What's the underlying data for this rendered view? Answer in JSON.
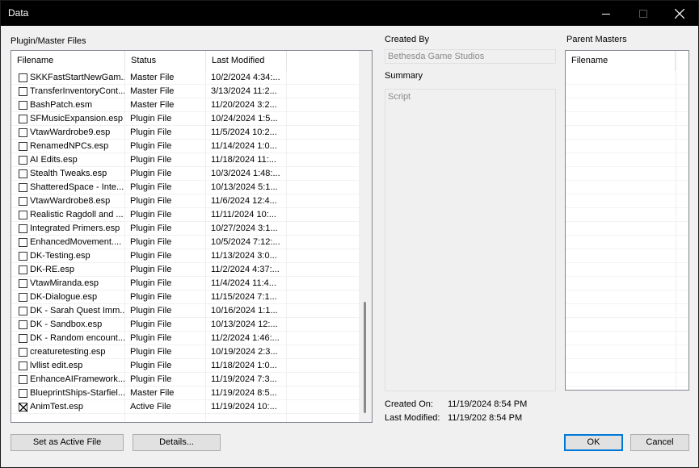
{
  "window": {
    "title": "Data"
  },
  "files": {
    "group_label": "Plugin/Master Files",
    "columns": [
      "Filename",
      "Status",
      "Last Modified"
    ],
    "rows": [
      {
        "name": "SKKFastStartNewGam...",
        "status": "Master File",
        "modified": "10/2/2024 4:34:...",
        "checked": false
      },
      {
        "name": "TransferInventoryCont...",
        "status": "Master File",
        "modified": "3/13/2024 11:2...",
        "checked": false
      },
      {
        "name": "BashPatch.esm",
        "status": "Master File",
        "modified": "11/20/2024 3:2...",
        "checked": false
      },
      {
        "name": "SFMusicExpansion.esp",
        "status": "Plugin File",
        "modified": "10/24/2024 1:5...",
        "checked": false
      },
      {
        "name": "VtawWardrobe9.esp",
        "status": "Plugin File",
        "modified": "11/5/2024 10:2...",
        "checked": false
      },
      {
        "name": "RenamedNPCs.esp",
        "status": "Plugin File",
        "modified": "11/14/2024 1:0...",
        "checked": false
      },
      {
        "name": "AI Edits.esp",
        "status": "Plugin File",
        "modified": "11/18/2024 11:...",
        "checked": false
      },
      {
        "name": "Stealth Tweaks.esp",
        "status": "Plugin File",
        "modified": "10/3/2024 1:48:...",
        "checked": false
      },
      {
        "name": "ShatteredSpace - Inte...",
        "status": "Plugin File",
        "modified": "10/13/2024 5:1...",
        "checked": false
      },
      {
        "name": "VtawWardrobe8.esp",
        "status": "Plugin File",
        "modified": "11/6/2024 12:4...",
        "checked": false
      },
      {
        "name": "Realistic Ragdoll and ...",
        "status": "Plugin File",
        "modified": "11/11/2024 10:...",
        "checked": false
      },
      {
        "name": "Integrated Primers.esp",
        "status": "Plugin File",
        "modified": "10/27/2024 3:1...",
        "checked": false
      },
      {
        "name": "EnhancedMovement....",
        "status": "Plugin File",
        "modified": "10/5/2024 7:12:...",
        "checked": false
      },
      {
        "name": "DK-Testing.esp",
        "status": "Plugin File",
        "modified": "11/13/2024 3:0...",
        "checked": false
      },
      {
        "name": "DK-RE.esp",
        "status": "Plugin File",
        "modified": "11/2/2024 4:37:...",
        "checked": false
      },
      {
        "name": "VtawMiranda.esp",
        "status": "Plugin File",
        "modified": "11/4/2024 11:4...",
        "checked": false
      },
      {
        "name": "DK-Dialogue.esp",
        "status": "Plugin File",
        "modified": "11/15/2024 7:1...",
        "checked": false
      },
      {
        "name": "DK - Sarah Quest Imm...",
        "status": "Plugin File",
        "modified": "10/16/2024 1:1...",
        "checked": false
      },
      {
        "name": "DK - Sandbox.esp",
        "status": "Plugin File",
        "modified": "10/13/2024 12:...",
        "checked": false
      },
      {
        "name": "DK - Random encount...",
        "status": "Plugin File",
        "modified": "11/2/2024 1:46:...",
        "checked": false
      },
      {
        "name": "creaturetesting.esp",
        "status": "Plugin File",
        "modified": "10/19/2024 2:3...",
        "checked": false
      },
      {
        "name": "lvllist edit.esp",
        "status": "Plugin File",
        "modified": "11/18/2024 1:0...",
        "checked": false
      },
      {
        "name": "EnhanceAIFramework...",
        "status": "Plugin File",
        "modified": "11/19/2024 7:3...",
        "checked": false
      },
      {
        "name": "BlueprintShips-Starfiel...",
        "status": "Master File",
        "modified": "11/19/2024 8:5...",
        "checked": false
      },
      {
        "name": "AnimTest.esp",
        "status": "Active File",
        "modified": "11/19/2024 10:...",
        "checked": true
      }
    ]
  },
  "info": {
    "created_by_label": "Created By",
    "created_by_value": "Bethesda Game Studios",
    "summary_label": "Summary",
    "summary_value": "Script",
    "created_on_label": "Created On:",
    "created_on_value": "11/19/2024 8:54 PM",
    "last_modified_label": "Last Modified:",
    "last_modified_value": "11/19/202 8:54 PM"
  },
  "parent_masters": {
    "label": "Parent Masters",
    "column": "Filename"
  },
  "buttons": {
    "set_active": "Set as Active File",
    "details": "Details...",
    "ok": "OK",
    "cancel": "Cancel"
  }
}
